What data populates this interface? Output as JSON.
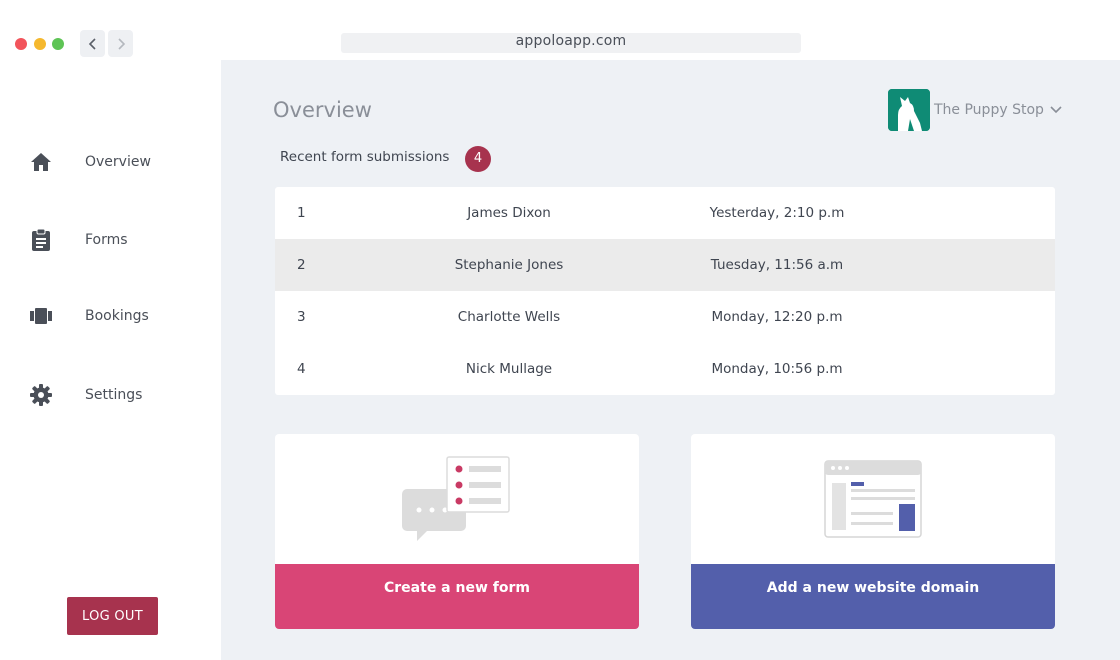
{
  "browser": {
    "url": "appoloapp.com"
  },
  "sidebar": {
    "items": [
      {
        "label": "Overview",
        "icon": "home-icon"
      },
      {
        "label": "Forms",
        "icon": "clipboard-icon"
      },
      {
        "label": "Bookings",
        "icon": "bookings-icon"
      },
      {
        "label": "Settings",
        "icon": "gear-icon"
      }
    ],
    "logout_label": "LOG OUT"
  },
  "header": {
    "title": "Overview",
    "org_name": "The Puppy Stop"
  },
  "submissions": {
    "title": "Recent form submissions",
    "count": "4",
    "rows": [
      {
        "num": "1",
        "name": "James Dixon",
        "time": "Yesterday, 2:10 p.m"
      },
      {
        "num": "2",
        "name": "Stephanie Jones",
        "time": "Tuesday, 11:56 a.m"
      },
      {
        "num": "3",
        "name": "Charlotte Wells",
        "time": "Monday, 12:20 p.m"
      },
      {
        "num": "4",
        "name": "Nick Mullage",
        "time": "Monday, 10:56 p.m"
      }
    ]
  },
  "cards": {
    "form_label": "Create a new form",
    "domain_label": "Add a new website domain"
  },
  "colors": {
    "accent_red": "#a7334e",
    "form_pink": "#d94576",
    "domain_blue": "#535fab",
    "brand_teal": "#0f8b75"
  }
}
